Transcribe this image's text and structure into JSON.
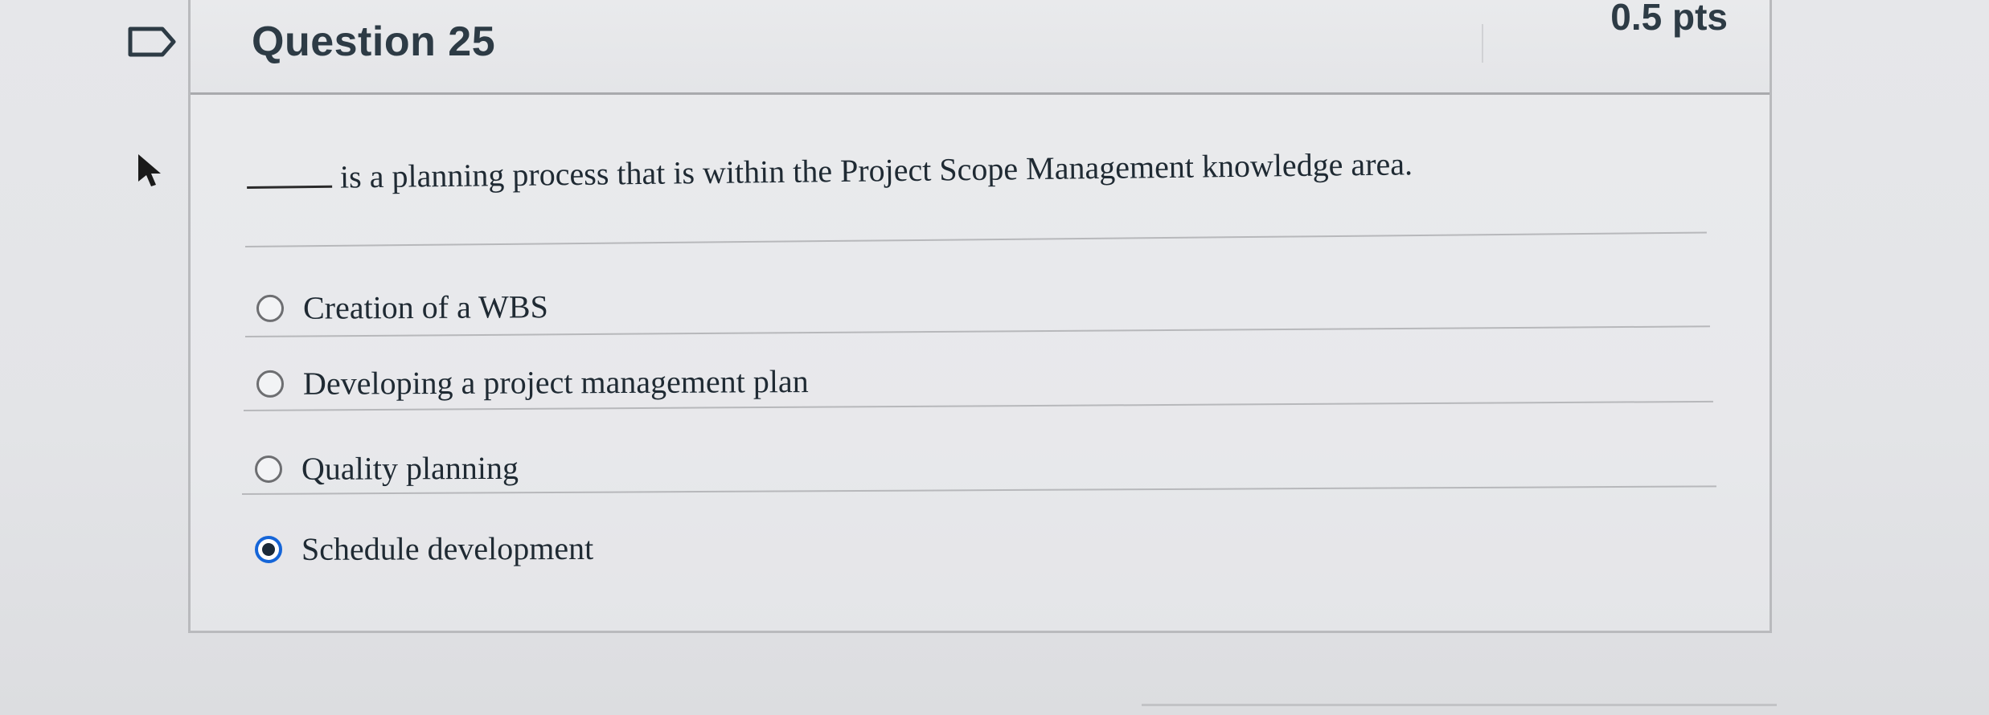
{
  "question": {
    "title": "Question 25",
    "points": "0.5 pts",
    "prompt": "is a planning process that is within the Project Scope Management knowledge area."
  },
  "answers": [
    {
      "label": "Creation of a WBS",
      "selected": false
    },
    {
      "label": "Developing a project management plan",
      "selected": false
    },
    {
      "label": "Quality planning",
      "selected": false
    },
    {
      "label": "Schedule development",
      "selected": true
    }
  ],
  "icons": {
    "flag": "flag-icon",
    "cursor": "mouse-pointer-icon"
  },
  "colors": {
    "selected_ring": "#1565d8",
    "text": "#1f2a33",
    "header_text": "#2d3b45"
  }
}
